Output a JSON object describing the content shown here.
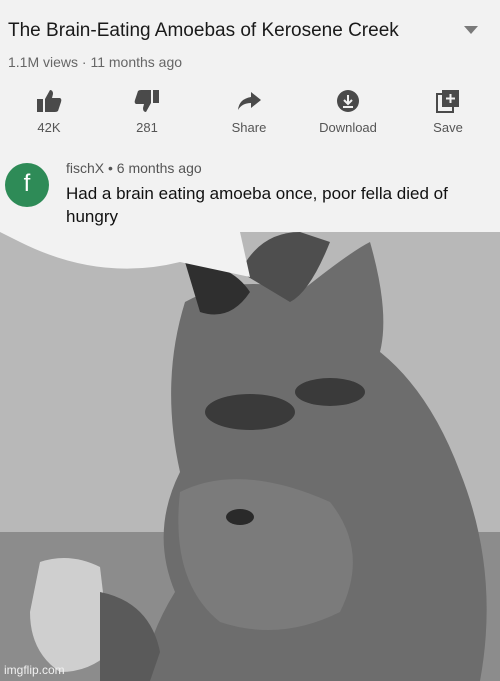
{
  "video": {
    "title": "The Brain-Eating Amoebas of Kerosene Creek",
    "meta": "1.1M views · 11 months ago"
  },
  "actions": [
    {
      "icon": "thumbs-up-icon",
      "label": "42K"
    },
    {
      "icon": "thumbs-down-icon",
      "label": "281"
    },
    {
      "icon": "share-icon",
      "label": "Share"
    },
    {
      "icon": "download-icon",
      "label": "Download"
    },
    {
      "icon": "save-icon",
      "label": "Save"
    }
  ],
  "comment": {
    "avatar_letter": "f",
    "author_line": "fischX • 6 months ago",
    "text": "Had a brain eating amoeba once, poor fella died of hungry"
  },
  "watermark": "imgflip.com",
  "colors": {
    "avatar": "#2e8b57"
  }
}
